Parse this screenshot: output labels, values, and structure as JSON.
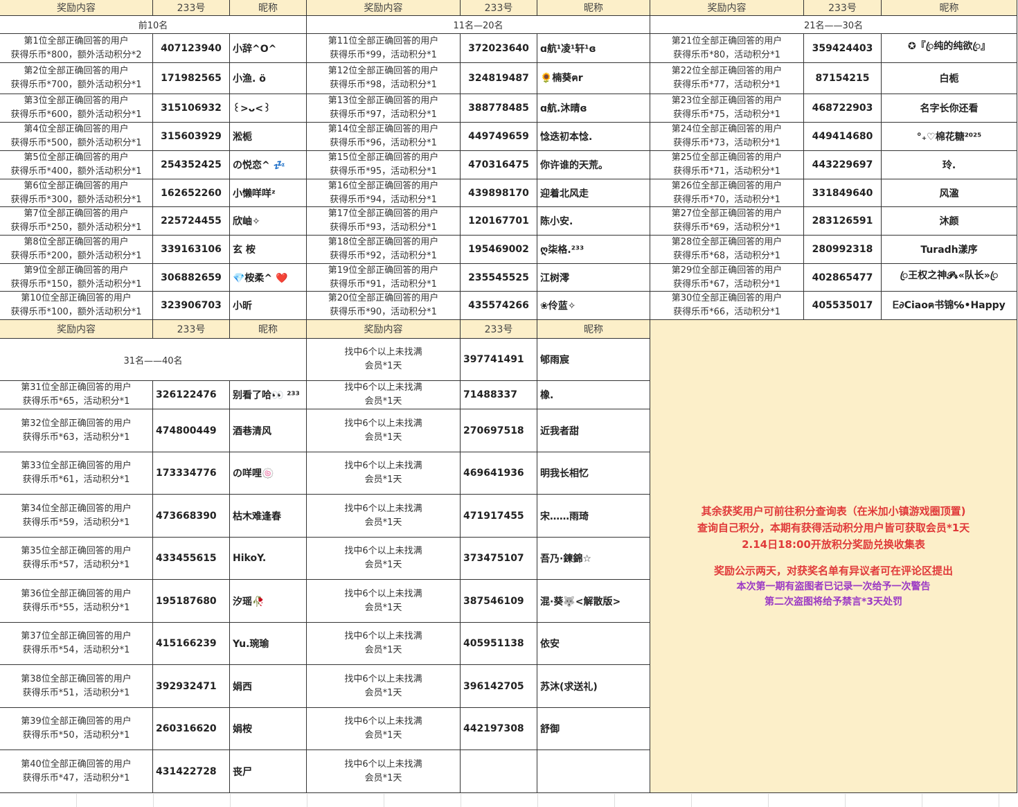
{
  "headers": {
    "reward": "奖励内容",
    "id": "233号",
    "nick": "昵称"
  },
  "sections": {
    "s1": "前10名",
    "s2": "11名—20名",
    "s3": "21名——30名",
    "s4": "31名——40名"
  },
  "vip_text": [
    "找中6个以上未找满",
    "会员*1天"
  ],
  "top10": [
    {
      "desc": [
        "第1位全部正确回答的用户",
        "获得乐币*800，额外活动积分*2"
      ],
      "id": "407123940",
      "nick": "小辞^O^"
    },
    {
      "desc": [
        "第2位全部正确回答的用户",
        "获得乐币*700，额外活动积分*1"
      ],
      "id": "171982565",
      "nick": "小渔. ö"
    },
    {
      "desc": [
        "第3位全部正确回答的用户",
        "获得乐币*600，额外活动积分*1"
      ],
      "id": "315106932",
      "nick": "꒰>ᴗ<꒱"
    },
    {
      "desc": [
        "第4位全部正确回答的用户",
        "获得乐币*500，额外活动积分*1"
      ],
      "id": "315603929",
      "nick": "淞栀"
    },
    {
      "desc": [
        "第5位全部正确回答的用户",
        "获得乐币*400，额外活动积分*1"
      ],
      "id": "254352425",
      "nick": "の悦恋^ 💤"
    },
    {
      "desc": [
        "第6位全部正确回答的用户",
        "获得乐币*300，额外活动积分*1"
      ],
      "id": "162652260",
      "nick": "小懒咩咩ᶻ"
    },
    {
      "desc": [
        "第7位全部正确回答的用户",
        "获得乐币*250，额外活动积分*1"
      ],
      "id": "225724455",
      "nick": "欣岫✧"
    },
    {
      "desc": [
        "第8位全部正确回答的用户",
        "获得乐币*200，额外活动积分*1"
      ],
      "id": "339163106",
      "nick": "玄 桉"
    },
    {
      "desc": [
        "第9位全部正确回答的用户",
        "获得乐币*150，额外活动积分*1"
      ],
      "id": "306882659",
      "nick": "💎桉柔^ ❤️"
    },
    {
      "desc": [
        "第10位全部正确回答的用户",
        "获得乐币*100，额外活动积分*1"
      ],
      "id": "323906703",
      "nick": "小昕"
    }
  ],
  "rank11_20": [
    {
      "desc": [
        "第11位全部正确回答的用户",
        "获得乐币*99，活动积分*1"
      ],
      "id": "372023640",
      "nick": "ɑ航¹凌¹轩¹ɞ"
    },
    {
      "desc": [
        "第12位全部正确回答的用户",
        "获得乐币*98，活动积分*1"
      ],
      "id": "324819487",
      "nick": "🌻楠葵ฅr"
    },
    {
      "desc": [
        "第13位全部正确回答的用户",
        "获得乐币*97，活动积分*1"
      ],
      "id": "388778485",
      "nick": "ɑ航.沐晴ɞ"
    },
    {
      "desc": [
        "第14位全部正确回答的用户",
        "获得乐币*96，活动积分*1"
      ],
      "id": "449749659",
      "nick": "惗迭初本惗."
    },
    {
      "desc": [
        "第15位全部正确回答的用户",
        "获得乐币*95，活动积分*1"
      ],
      "id": "470316475",
      "nick": "你许谁的天荒。"
    },
    {
      "desc": [
        "第16位全部正确回答的用户",
        "获得乐币*94，活动积分*1"
      ],
      "id": "439898170",
      "nick": "迎着北风走"
    },
    {
      "desc": [
        "第17位全部正确回答的用户",
        "获得乐币*93，活动积分*1"
      ],
      "id": "120167701",
      "nick": "陈小安."
    },
    {
      "desc": [
        "第18位全部正确回答的用户",
        "获得乐币*92，活动积分*1"
      ],
      "id": "195469002",
      "nick": "ღ柒格.²³³"
    },
    {
      "desc": [
        "第19位全部正确回答的用户",
        "获得乐币*91，活动积分*1"
      ],
      "id": "235545525",
      "nick": "江树澪"
    },
    {
      "desc": [
        "第20位全部正确回答的用户",
        "获得乐币*90，活动积分*1"
      ],
      "id": "435574266",
      "nick": "❀伶蓝✧"
    }
  ],
  "rank21_30": [
    {
      "desc": [
        "第21位全部正确回答的用户",
        "获得乐币*80，活动积分*1"
      ],
      "id": "359424403",
      "nick": "✪『ꦿ纯的纯欲ꦿ』"
    },
    {
      "desc": [
        "第22位全部正确回答的用户",
        "获得乐币*77，活动积分*1"
      ],
      "id": "87154215",
      "nick": "白栀"
    },
    {
      "desc": [
        "第23位全部正确回答的用户",
        "获得乐币*75，活动积分*1"
      ],
      "id": "468722903",
      "nick": "名字长你还看"
    },
    {
      "desc": [
        "第24位全部正确回答的用户",
        "获得乐币*73，活动积分*1"
      ],
      "id": "449414680",
      "nick": "°₊♡棉花糖²⁰²⁵"
    },
    {
      "desc": [
        "第25位全部正确回答的用户",
        "获得乐币*71，活动积分*1"
      ],
      "id": "443229697",
      "nick": "玲."
    },
    {
      "desc": [
        "第26位全部正确回答的用户",
        "获得乐币*70，活动积分*1"
      ],
      "id": "331849640",
      "nick": "风溋"
    },
    {
      "desc": [
        "第27位全部正确回答的用户",
        "获得乐币*69，活动积分*1"
      ],
      "id": "283126591",
      "nick": "沐颜"
    },
    {
      "desc": [
        "第28位全部正确回答的用户",
        "获得乐币*68，活动积分*1"
      ],
      "id": "280992318",
      "nick": "Turadh漾序"
    },
    {
      "desc": [
        "第29位全部正确回答的用户",
        "获得乐币*67，活动积分*1"
      ],
      "id": "402865477",
      "nick": "ꦿ王权之神𝓟𝓻«队长»ꦿ"
    },
    {
      "desc": [
        "第30位全部正确回答的用户",
        "获得乐币*66，活动积分*1"
      ],
      "id": "405535017",
      "nick": "Ꭼ∂Ciaoฅ书锦℅•Happy"
    }
  ],
  "rank31_40": [
    {
      "desc": [
        "第31位全部正确回答的用户",
        "获得乐币*65，活动积分*1"
      ],
      "id": "326122476",
      "nick": "别看了哈👀 ²³³"
    },
    {
      "desc": [
        "第32位全部正确回答的用户",
        "获得乐币*63，活动积分*1"
      ],
      "id": "474800449",
      "nick": "酒巷清风"
    },
    {
      "desc": [
        "第33位全部正确回答的用户",
        "获得乐币*61，活动积分*1"
      ],
      "id": "173334776",
      "nick": "の咩哩🍥"
    },
    {
      "desc": [
        "第34位全部正确回答的用户",
        "获得乐币*59，活动积分*1"
      ],
      "id": "473668390",
      "nick": "枯木难逢春"
    },
    {
      "desc": [
        "第35位全部正确回答的用户",
        "获得乐币*57，活动积分*1"
      ],
      "id": "433455615",
      "nick": "HikoY."
    },
    {
      "desc": [
        "第36位全部正确回答的用户",
        "获得乐币*55，活动积分*1"
      ],
      "id": "195187680",
      "nick": "汐瑶🥀"
    },
    {
      "desc": [
        "第37位全部正确回答的用户",
        "获得乐币*54，活动积分*1"
      ],
      "id": "415166239",
      "nick": "Yu.琬瑜"
    },
    {
      "desc": [
        "第38位全部正确回答的用户",
        "获得乐币*51，活动积分*1"
      ],
      "id": "392932471",
      "nick": "娟西"
    },
    {
      "desc": [
        "第39位全部正确回答的用户",
        "获得乐币*50，活动积分*1"
      ],
      "id": "260316620",
      "nick": "娟桉"
    },
    {
      "desc": [
        "第40位全部正确回答的用户",
        "获得乐币*47，活动积分*1"
      ],
      "id": "431422728",
      "nick": "丧尸"
    }
  ],
  "vip_list": [
    {
      "id": "397741491",
      "nick": "郇雨宸"
    },
    {
      "id": "71488337",
      "nick": "橡."
    },
    {
      "id": "270697518",
      "nick": "近我者甜"
    },
    {
      "id": "469641936",
      "nick": "明我长相忆"
    },
    {
      "id": "471917455",
      "nick": "宋……雨琦"
    },
    {
      "id": "373475107",
      "nick": "吾乃·鍊錦☆"
    },
    {
      "id": "387546109",
      "nick": "混·葵🐺<解散版>"
    },
    {
      "id": "405951138",
      "nick": "依安"
    },
    {
      "id": "396142705",
      "nick": "苏沐(求送礼)"
    },
    {
      "id": "442197308",
      "nick": "舒御"
    },
    {
      "id": "",
      "nick": ""
    }
  ],
  "notice": {
    "red_lines": [
      "其余获奖用户可前往积分查询表（在米加小镇游戏圈顶置)",
      "查询自己积分，本期有获得活动积分用户皆可获取会员*1天",
      "2.14日18:00开放积分奖励兑换收集表"
    ],
    "red_line2": "奖励公示两天，对获奖名单有异议者可在评论区提出",
    "purple_lines": [
      "本次第一期有盗图者已记录一次给予一次警告",
      "第二次盗图将给予禁言*3天处罚"
    ]
  }
}
